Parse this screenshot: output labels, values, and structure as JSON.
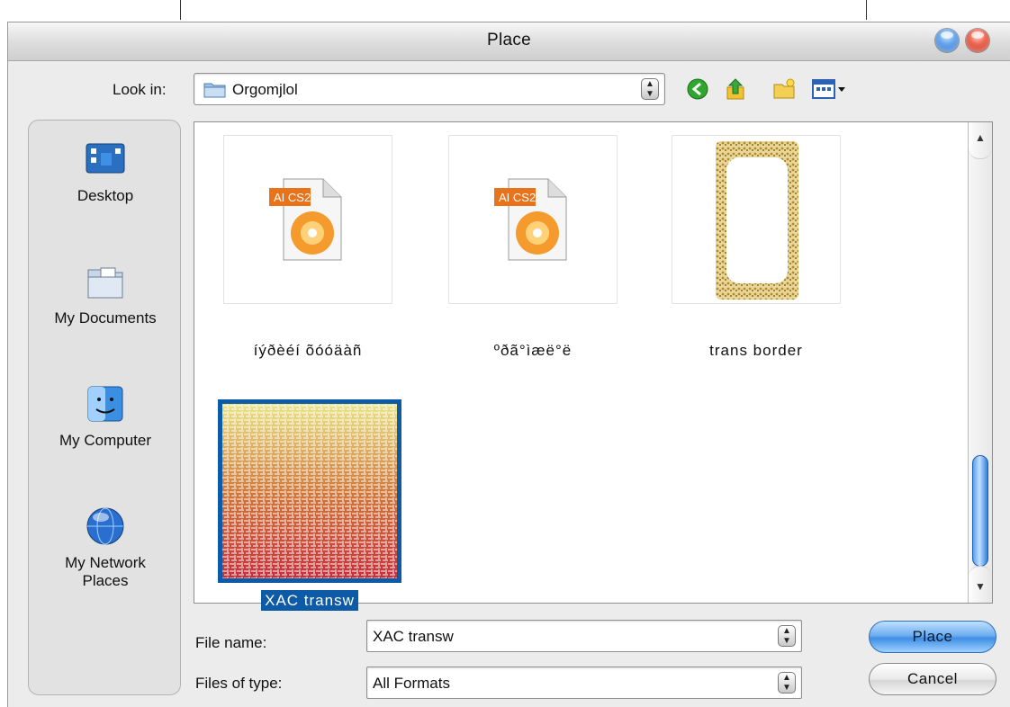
{
  "window": {
    "title": "Place"
  },
  "lookin": {
    "label": "Look in:",
    "value": "Orgomjlol"
  },
  "toolbar": {
    "icons": [
      "back-icon",
      "up-folder-icon",
      "new-folder-icon",
      "view-menu-icon"
    ]
  },
  "places": [
    {
      "label": "Desktop",
      "icon": "desktop-icon"
    },
    {
      "label": "My Documents",
      "icon": "documents-folder-icon"
    },
    {
      "label": "My Computer",
      "icon": "computer-icon"
    },
    {
      "label": "My Network Places",
      "label_line1": "My Network",
      "label_line2": "Places",
      "icon": "network-globe-icon"
    }
  ],
  "files": [
    {
      "name": "íýðèéí õóóäàñ",
      "thumbnail": "ai-cs2-file-icon",
      "badge": "AI CS2"
    },
    {
      "name": "ºðã°ìæë°ë",
      "thumbnail": "ai-cs2-file-icon",
      "badge": "AI CS2"
    },
    {
      "name": "trans border",
      "thumbnail": "gold-border-image"
    },
    {
      "name": "XAC transw",
      "thumbnail": "gradient-pattern-image",
      "selected": true
    }
  ],
  "form": {
    "filename_label": "File name:",
    "filename_value": "XAC transw",
    "filetype_label": "Files of type:",
    "filetype_value": "All Formats"
  },
  "buttons": {
    "place": "Place",
    "cancel": "Cancel"
  },
  "colors": {
    "selection": "#0d5aa7",
    "accent": "#3f8fe5"
  }
}
